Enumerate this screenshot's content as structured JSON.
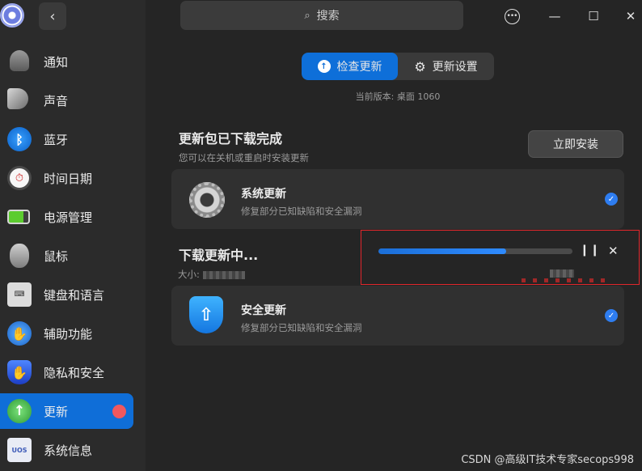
{
  "window": {
    "search_placeholder": "搜索"
  },
  "sidebar": {
    "items": [
      {
        "label": "通知",
        "icon": "bell-icon"
      },
      {
        "label": "声音",
        "icon": "speaker-icon"
      },
      {
        "label": "蓝牙",
        "icon": "bluetooth-icon"
      },
      {
        "label": "时间日期",
        "icon": "clock-icon"
      },
      {
        "label": "电源管理",
        "icon": "battery-icon"
      },
      {
        "label": "鼠标",
        "icon": "mouse-icon"
      },
      {
        "label": "键盘和语言",
        "icon": "keyboard-icon"
      },
      {
        "label": "辅助功能",
        "icon": "accessibility-icon"
      },
      {
        "label": "隐私和安全",
        "icon": "privacy-icon"
      },
      {
        "label": "更新",
        "icon": "update-icon",
        "active": true,
        "badge": true
      },
      {
        "label": "系统信息",
        "icon": "system-info-icon"
      }
    ],
    "sysinfo_icon_text": "UOS"
  },
  "tabs": {
    "check_update": "检查更新",
    "update_settings": "更新设置"
  },
  "version": "当前版本: 桌面 1060",
  "downloaded": {
    "title": "更新包已下载完成",
    "subtitle": "您可以在关机或重启时安装更新",
    "install_button": "立即安装"
  },
  "system_update": {
    "title": "系统更新",
    "desc": "修复部分已知缺陷和安全漏洞"
  },
  "downloading": {
    "title": "下载更新中...",
    "size_label": "大小:",
    "progress": 0.66
  },
  "security_update": {
    "title": "安全更新",
    "desc": "修复部分已知缺陷和安全漏洞"
  },
  "watermark": "CSDN @高级IT技术专家secops998",
  "colors": {
    "accent": "#0f6ed8",
    "badge": "#f0585f",
    "highlight": "#e0262b"
  }
}
